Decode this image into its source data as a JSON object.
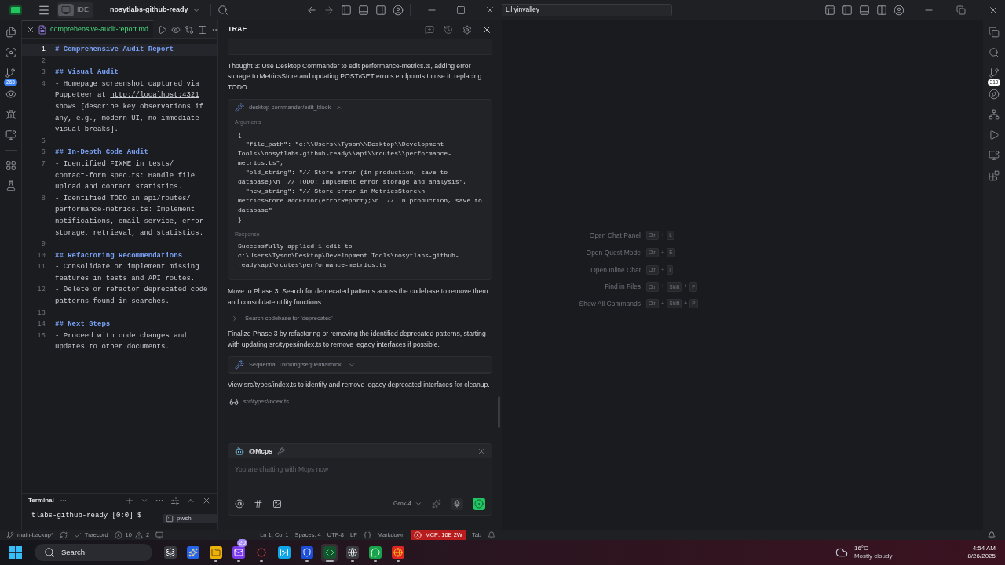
{
  "left_window": {
    "title_bar": {
      "mode_label": "IDE",
      "project": "nosytlabs-github-ready"
    },
    "activity_bar": {
      "scm_badge": "263"
    },
    "editor": {
      "tab": {
        "filename": "comprehensive-audit-report.md"
      },
      "lines": [
        {
          "number": "1",
          "kind": "heading",
          "active": true,
          "rows": [
            "# Comprehensive Audit Report"
          ]
        },
        {
          "number": "2",
          "active": false
        },
        {
          "number": "3",
          "kind": "heading",
          "active": false,
          "rows": [
            "## Visual Audit"
          ]
        },
        {
          "number": "4",
          "kind": "text",
          "active": false,
          "rows": [
            "- Homepage screenshot captured via",
            {
              "text": "Puppeteer at ",
              "link": "http://localhost:4321"
            },
            "shows [describe key observations if",
            "any, e.g., modern UI, no immediate",
            "visual breaks]."
          ]
        },
        {
          "number": "5",
          "active": false
        },
        {
          "number": "6",
          "kind": "heading",
          "active": false,
          "rows": [
            "## In-Depth Code Audit"
          ]
        },
        {
          "number": "7",
          "kind": "text",
          "active": false,
          "rows": [
            "- Identified FIXME in tests/",
            "contact-form.spec.ts: Handle file",
            "upload and contact statistics."
          ]
        },
        {
          "number": "8",
          "kind": "text",
          "active": false,
          "rows": [
            "- Identified TODO in api/routes/",
            "performance-metrics.ts: Implement",
            "notifications, email service, error",
            "storage, retrieval, and statistics."
          ]
        },
        {
          "number": "9",
          "active": false
        },
        {
          "number": "10",
          "kind": "heading",
          "active": false,
          "rows": [
            "## Refactoring Recommendations"
          ]
        },
        {
          "number": "11",
          "kind": "text",
          "active": false,
          "rows": [
            "- Consolidate or implement missing",
            "features in tests and API routes."
          ]
        },
        {
          "number": "12",
          "kind": "text",
          "active": false,
          "rows": [
            "- Delete or refactor deprecated code",
            "patterns found in searches."
          ]
        },
        {
          "number": "13",
          "active": false
        },
        {
          "number": "14",
          "kind": "heading",
          "active": false,
          "rows": [
            "## Next Steps"
          ]
        },
        {
          "number": "15",
          "kind": "text",
          "active": false,
          "rows": [
            "- Proceed with code changes and",
            "updates to other documents."
          ]
        }
      ]
    },
    "terminal": {
      "title": "Terminal",
      "more": "···",
      "prompt": "tlabs-github-ready [0:0] $",
      "sessions": [
        {
          "label": "pwsh",
          "selected": true
        }
      ]
    },
    "chat": {
      "title": "TRAE",
      "messages": [
        {
          "kind": "text",
          "text": "Thought 3: Use Desktop Commander to edit performance-metrics.ts, adding error storage to MetricsStore and updating POST/GET errors endpoints to use it, replacing TODO."
        },
        {
          "kind": "tool",
          "name": "desktop-commander/edit_block",
          "expanded": true,
          "arguments_label": "Arguments",
          "arguments": [
            "{",
            "  \"file_path\": \"c:\\\\Users\\\\Tyson\\\\Desktop\\\\Development",
            "Tools\\\\nosytlabs-github-ready\\\\api\\\\routes\\\\performance-",
            "metrics.ts\",",
            "  \"old_string\": \"// Store error (in production, save to",
            "database)\\n  // TODO: Implement error storage and analysis\",",
            "  \"new_string\": \"// Store error in MetricsStore\\n",
            "metricsStore.addError(errorReport);\\n  // In production, save to",
            "database\"",
            "}"
          ],
          "response_label": "Response",
          "response": [
            "Successfully applied 1 edit to",
            "c:\\Users\\Tyson\\Desktop\\Development Tools\\nosytlabs-github-",
            "ready\\api\\routes\\performance-metrics.ts"
          ]
        },
        {
          "kind": "text",
          "text": "Move to Phase 3: Search for deprecated patterns across the codebase to remove them and consolidate utility functions."
        },
        {
          "kind": "step",
          "text": "Search codebase for 'deprecated'",
          "expanded": false
        },
        {
          "kind": "text",
          "text": "Finalize Phase 3 by refactoring or removing the identified deprecated patterns, starting with updating src/types/index.ts to remove legacy interfaces if possible."
        },
        {
          "kind": "tool",
          "name": "Sequential Thinking/sequentialthinki",
          "expanded": false
        },
        {
          "kind": "text",
          "text": "View src/types/index.ts to identify and remove legacy deprecated interfaces for cleanup."
        },
        {
          "kind": "file",
          "text": "src\\types\\index.ts"
        }
      ],
      "input": {
        "agent": "@Mcps",
        "placeholder": "You are chatting with Mcps now",
        "model": "Grok-4"
      }
    },
    "status_bar": {
      "branch": "main-backup*",
      "extension": "Traecord",
      "errors": "10",
      "warnings": "2",
      "position": "Ln 1, Col 1",
      "indent": "Spaces: 4",
      "encoding": "UTF-8",
      "eol": "LF",
      "language": "Markdown",
      "mcp": "MCP: 10E 2W",
      "tab_mode": "Tab"
    }
  },
  "right_window": {
    "search": "Lillyinvalley",
    "scm_badge": "310",
    "shortcuts": {
      "joiner": "+",
      "items": [
        {
          "label": "Open Chat Panel",
          "keys": [
            "Ctrl",
            "L"
          ]
        },
        {
          "label": "Open Quest Mode",
          "keys": [
            "Ctrl",
            "E"
          ]
        },
        {
          "label": "Open Inline Chat",
          "keys": [
            "Ctrl",
            "I"
          ]
        },
        {
          "label": "Find in Files",
          "keys": [
            "Ctrl",
            "Shift",
            "F"
          ]
        },
        {
          "label": "Show All Commands",
          "keys": [
            "Ctrl",
            "Shift",
            "P"
          ]
        }
      ]
    }
  },
  "taskbar": {
    "search": "Search",
    "apps": [
      {
        "kind": "task_view",
        "running": false,
        "selected": false
      },
      {
        "kind": "copilot",
        "running": false,
        "selected": false
      },
      {
        "kind": "files",
        "running": true,
        "selected": false
      },
      {
        "kind": "mail",
        "running": true,
        "selected": false,
        "badge": "20"
      },
      {
        "kind": "opera",
        "running": true,
        "selected": false
      },
      {
        "kind": "photos",
        "running": false,
        "selected": false
      },
      {
        "kind": "bitwarden",
        "running": true,
        "selected": false
      },
      {
        "kind": "ide",
        "running": true,
        "selected": true
      },
      {
        "kind": "chatgpt",
        "running": true,
        "selected": false
      },
      {
        "kind": "messenger",
        "running": true,
        "selected": false
      },
      {
        "kind": "chrome",
        "running": true,
        "selected": false
      }
    ],
    "weather": {
      "temperature": "16°C",
      "condition": "Mostly cloudy"
    },
    "clock": {
      "time": "4:54 AM",
      "date": "8/26/2025"
    }
  }
}
